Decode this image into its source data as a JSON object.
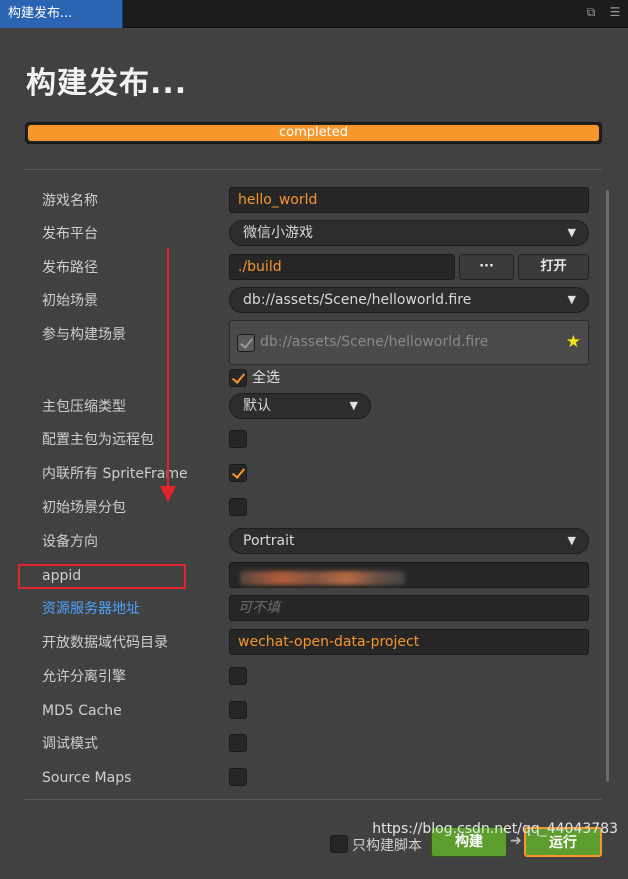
{
  "tab": {
    "title": "构建发布..."
  },
  "page": {
    "title": "构建发布..."
  },
  "progress": {
    "label": "completed",
    "percent": 100
  },
  "form": {
    "game_name": {
      "label": "游戏名称",
      "value": "hello_world"
    },
    "platform": {
      "label": "发布平台",
      "value": "微信小游戏"
    },
    "build_path": {
      "label": "发布路径",
      "value": "./build",
      "browse_label": "···",
      "open_label": "打开"
    },
    "start_scene": {
      "label": "初始场景",
      "value": "db://assets/Scene/helloworld.fire"
    },
    "included_scenes": {
      "label": "参与构建场景",
      "item": "db://assets/Scene/helloworld.fire",
      "select_all_label": "全选"
    },
    "compression": {
      "label": "主包压缩类型",
      "value": "默认"
    },
    "remote_main": {
      "label": "配置主包为远程包",
      "checked": false
    },
    "inline_spriteframe": {
      "label": "内联所有 SpriteFrame",
      "checked": true
    },
    "start_scene_subpackage": {
      "label": "初始场景分包",
      "checked": false
    },
    "orientation": {
      "label": "设备方向",
      "value": "Portrait"
    },
    "appid": {
      "label": "appid",
      "value": ""
    },
    "server": {
      "label": "资源服务器地址",
      "placeholder": "可不填"
    },
    "open_data": {
      "label": "开放数据域代码目录",
      "value": "wechat-open-data-project"
    },
    "separate_engine": {
      "label": "允许分离引擎",
      "checked": false
    },
    "md5": {
      "label": "MD5 Cache",
      "checked": false
    },
    "debug": {
      "label": "调试模式",
      "checked": false
    },
    "source_maps": {
      "label": "Source Maps",
      "checked": false
    }
  },
  "footer": {
    "build_script_only": "只构建脚本",
    "build_label": "构建",
    "run_label": "运行"
  },
  "watermark": "https://blog.csdn.net/qq_44043783",
  "colors": {
    "accent": "#f7962b",
    "tab": "#2b64b3",
    "button_green": "#5c9d2e",
    "annotation": "#e0252b"
  }
}
